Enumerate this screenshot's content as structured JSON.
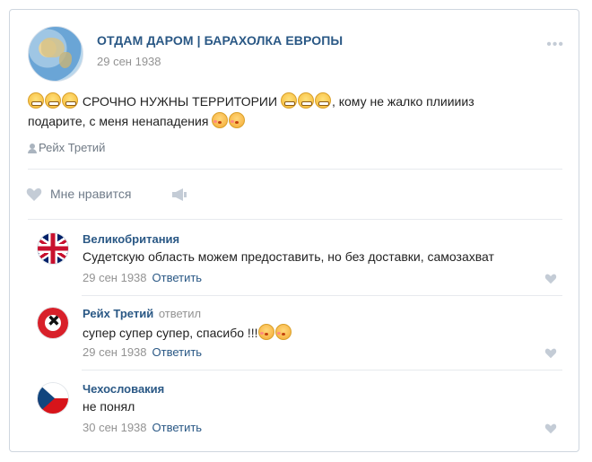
{
  "post": {
    "group_name": "ОТДАМ ДАРОМ | БАРАХОЛКА ЕВРОПЫ",
    "date": "29 сен 1938",
    "text_part1": "СРОЧНО НУЖНЫ ТЕРРИТОРИИ",
    "text_part2": ", кому не жалко плииииз",
    "text_line2": "подарите, с меня ненападения",
    "author": "Рейх Третий",
    "like_label": "Мне нравится"
  },
  "comments": [
    {
      "name": "Великобритания",
      "replied": "",
      "text": "Судетскую область можем предоставить, но без доставки, самозахват",
      "date": "29 сен 1938",
      "reply": "Ответить",
      "flag": "uk-flag"
    },
    {
      "name": "Рейх Третий",
      "replied": "ответил",
      "text": "супер супер супер, спасибо !!!",
      "date": "29 сен 1938",
      "reply": "Ответить",
      "flag": "reich-flag"
    },
    {
      "name": "Чехословакия",
      "replied": "",
      "text": "не понял",
      "date": "30 сен 1938",
      "reply": "Ответить",
      "flag": "czech-flag"
    }
  ],
  "colors": {
    "link": "#2a5885",
    "muted": "#939393",
    "divider": "#e7eaee"
  },
  "icons": [
    "more-icon",
    "user-icon",
    "heart-icon",
    "share-icon",
    "grin-emoji",
    "kiss-emoji"
  ]
}
